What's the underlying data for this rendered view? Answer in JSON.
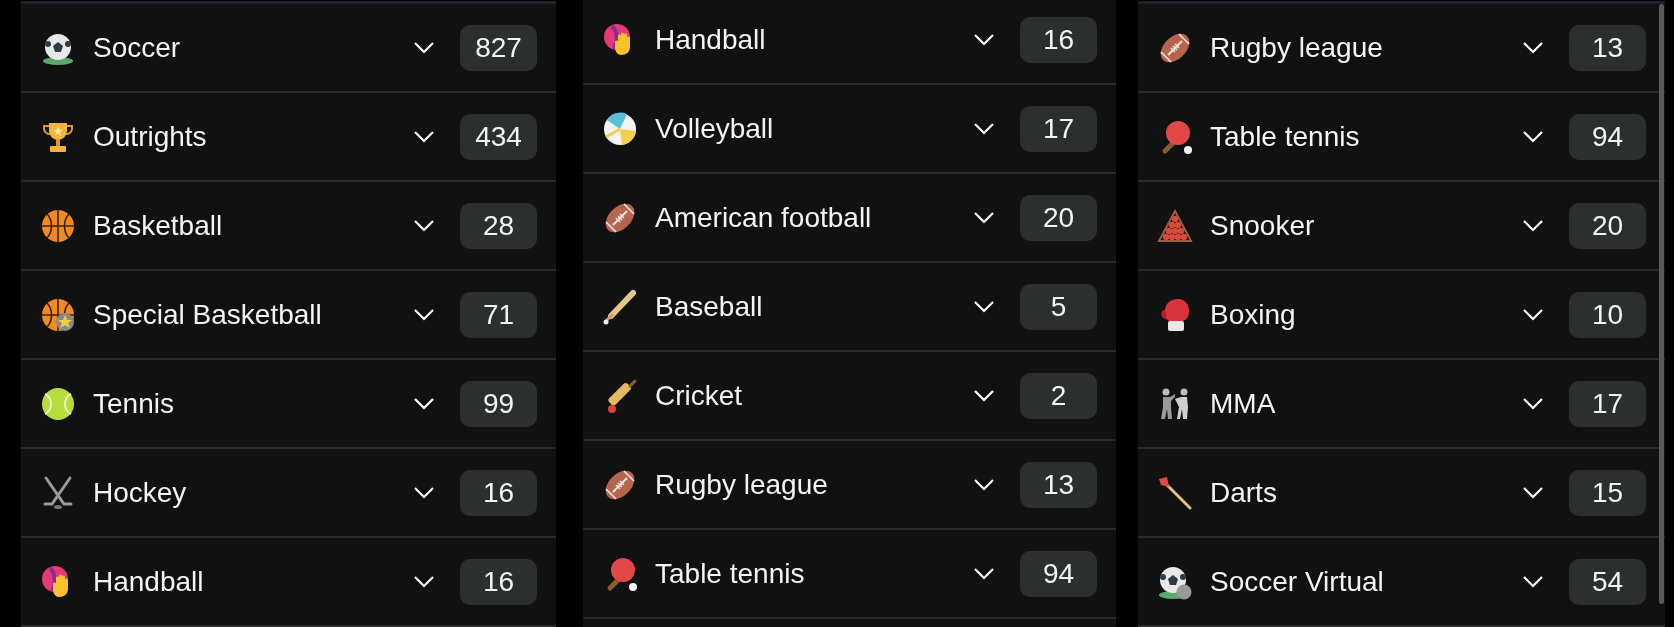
{
  "columns": [
    {
      "sports": [
        {
          "kind": "soccer",
          "name": "Soccer",
          "count": "827"
        },
        {
          "kind": "trophy",
          "name": "Outrights",
          "count": "434"
        },
        {
          "kind": "basketball",
          "name": "Basketball",
          "count": "28"
        },
        {
          "kind": "special-basketball",
          "name": "Special Basketball",
          "count": "71"
        },
        {
          "kind": "tennis",
          "name": "Tennis",
          "count": "99"
        },
        {
          "kind": "hockey",
          "name": "Hockey",
          "count": "16"
        },
        {
          "kind": "handball",
          "name": "Handball",
          "count": "16"
        }
      ]
    },
    {
      "sports": [
        {
          "kind": "handball",
          "name": "Handball",
          "count": "16"
        },
        {
          "kind": "volleyball",
          "name": "Volleyball",
          "count": "17"
        },
        {
          "kind": "football",
          "name": "American football",
          "count": "20"
        },
        {
          "kind": "baseball",
          "name": "Baseball",
          "count": "5"
        },
        {
          "kind": "cricket",
          "name": "Cricket",
          "count": "2"
        },
        {
          "kind": "football",
          "name": "Rugby league",
          "count": "13"
        },
        {
          "kind": "table-tennis",
          "name": "Table tennis",
          "count": "94"
        }
      ]
    },
    {
      "sports": [
        {
          "kind": "football",
          "name": "Rugby league",
          "count": "13"
        },
        {
          "kind": "table-tennis",
          "name": "Table tennis",
          "count": "94"
        },
        {
          "kind": "snooker",
          "name": "Snooker",
          "count": "20"
        },
        {
          "kind": "boxing",
          "name": "Boxing",
          "count": "10"
        },
        {
          "kind": "mma",
          "name": "MMA",
          "count": "17"
        },
        {
          "kind": "darts",
          "name": "Darts",
          "count": "15"
        },
        {
          "kind": "soccer-virtual",
          "name": "Soccer Virtual",
          "count": "54"
        }
      ]
    }
  ]
}
